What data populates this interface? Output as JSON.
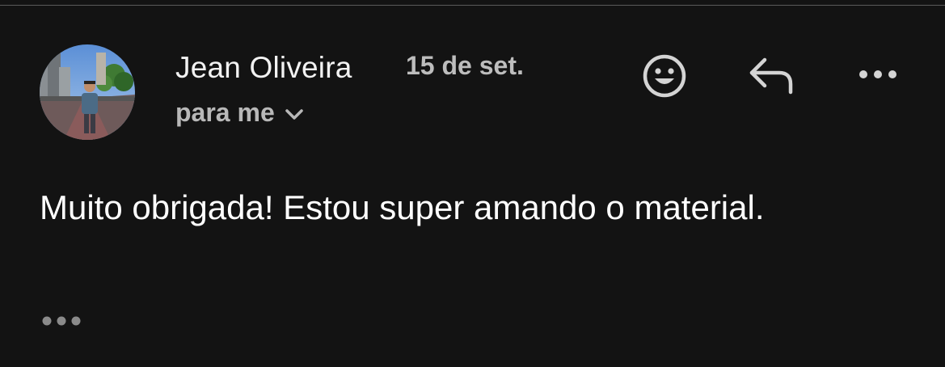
{
  "message": {
    "sender_name": "Jean Oliveira",
    "date": "15 de set.",
    "recipient_label": "para me",
    "body": "Muito obrigada! Estou super amando o material."
  },
  "icons": {
    "recipient_expand": "chevron-down-icon",
    "emoji": "emoji-smile-icon",
    "reply": "reply-arrow-icon",
    "more": "more-horizontal-icon",
    "quoted_toggle": "ellipsis-icon"
  },
  "colors": {
    "background": "#131313",
    "primary_text": "#ffffff",
    "secondary_text": "#bdbdbd",
    "icon": "#d4d4d4"
  }
}
